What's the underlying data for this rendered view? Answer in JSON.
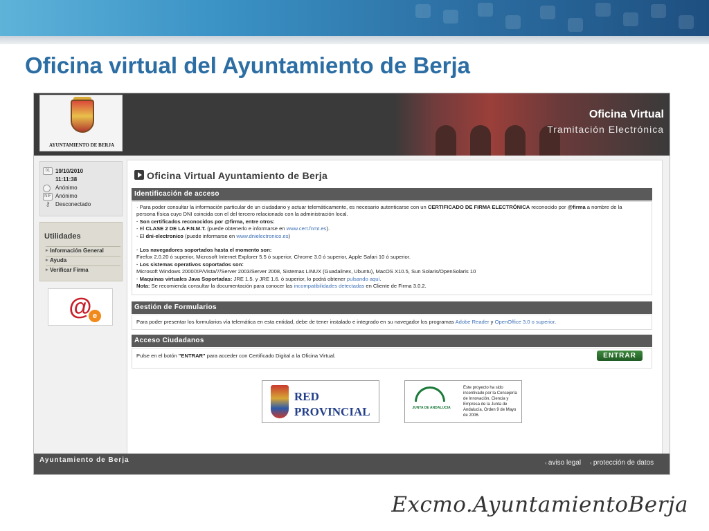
{
  "slide": {
    "title": "Oficina virtual del Ayuntamiento de Berja",
    "footer": "Excmo.AyuntamientoBerja"
  },
  "site": {
    "logo_caption": "AYUNTAMIENTO DE BERJA",
    "header_title": "Oficina Virtual",
    "header_subtitle": "Tramitación Electrónica"
  },
  "sidebar": {
    "date": "19/10/2010",
    "time": "11:11:38",
    "user1": "Anónimo",
    "user2": "Anónimo",
    "status": "Desconectado",
    "utilities_title": "Utilidades",
    "items": [
      {
        "label": "Información General"
      },
      {
        "label": "Ayuda"
      },
      {
        "label": "Verificar Firma"
      }
    ]
  },
  "main": {
    "title": "Oficina Virtual Ayuntamiento de Berja",
    "sections": [
      {
        "title": "Identificación de acceso"
      },
      {
        "title": "Gestión de Formularios"
      },
      {
        "title": "Acceso Ciudadanos"
      }
    ],
    "ident": {
      "l1a": "· Para poder consultar la información particular de un ciudadano y actuar telemáticamente, es necesario autenticarse con un ",
      "l1b": "CERTIFICADO DE FIRMA ELECTRÓNICA",
      "l1c": " reconocido por ",
      "l1d": "@firma",
      "l1e": " a nombre de la",
      "l2": "persona física cuyo DNI coincida con el del tercero relacionado con la administración local.",
      "l3": "· Son certificados reconocidos por @firma, entre otros:",
      "l4a": "- El ",
      "l4b": "CLASE 2 DE LA F.N.M.T.",
      "l4c": " (puede obtenerlo e informarse en ",
      "l4d": "www.cert.fnmt.es",
      "l4e": ").",
      "l5a": "- El ",
      "l5b": "dni-electronico",
      "l5c": " (puede informarse en ",
      "l5d": "www.dnielectronico.es",
      "l5e": ")",
      "l6": "· Los navegadores soportados hasta el momento son:",
      "l7": "Firefox 2.0.20 ó superior, Microsoft Internet Explorer 5.5 ó superior, Chrome 3.0 ó superior, Apple Safari 10 ó superior.",
      "l8": "· Los sistemas operativos soportados son:",
      "l9": "Microsoft Windows 2000/XP/Vista/7/Server 2003/Server 2008, Sistemas LINUX (Guadalinex, Ubuntu), MacOS X10.5, Sun Solaris/OpenSolaris 10",
      "l10a": "· Maquinas virtuales Java Soportadas:",
      "l10b": " JRE 1.5. y JRE 1.6. ó superior, lo podrá obtener ",
      "l10c": "pulsando aquí",
      "l10d": ".",
      "l11a": "Nota:",
      "l11b": " Se recomienda consultar la documentación para conocer las ",
      "l11c": "incompatibilidades detectadas",
      "l11d": " en Cliente de Firma 3.0.2."
    },
    "forms": {
      "text": "Para poder presentar los formularios vía telemática en esta entidad, debe de tener instalado e integrado en su navegador los programas ",
      "link1": "Adobe Reader",
      "mid": " y ",
      "link2": "OpenOffice 3.0 o superior",
      "end": "."
    },
    "access": {
      "text_a": "Pulse en el botón ",
      "text_b": "\"ENTRAR\"",
      "text_c": " para acceder con Certificado Digital a la Oficina Virtual.",
      "button": "ENTRAR"
    },
    "red_provincial_l1": "RED",
    "red_provincial_l2": "PROVINCIAL",
    "junta_logo": "JUNTA DE ANDALUCIA",
    "junta_text": "Este proyecto ha sido incentivado por la Consejería de Innovación, Ciencia y Empresa de la Junta de Andalucía, Orden 9 de Mayo de 2006."
  },
  "footer": {
    "left": "Ayuntamiento de Berja",
    "link1": "aviso legal",
    "link2": "protección de datos"
  }
}
